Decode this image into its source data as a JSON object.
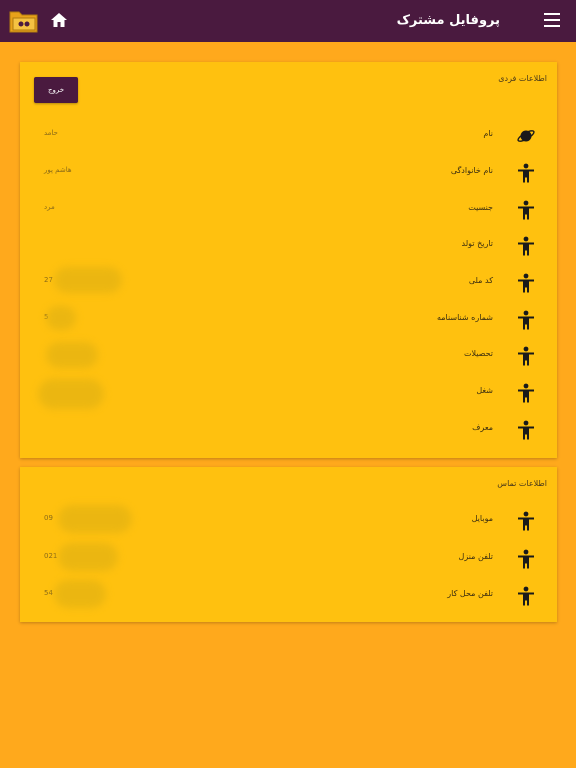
{
  "header": {
    "title": "پروفایل مشترک",
    "icons": [
      "menu-icon",
      "home-icon",
      "folder-icon"
    ]
  },
  "personal": {
    "title": "اطلاعات فردی",
    "logout_label": "خروج",
    "rows": [
      {
        "label": "نام",
        "value": "حامد",
        "icon": "planet-icon"
      },
      {
        "label": "نام خانوادگی",
        "value": "هاشم پور",
        "icon": "person-icon"
      },
      {
        "label": "جنسیت",
        "value": "مرد",
        "icon": "person-icon"
      },
      {
        "label": "تاریخ تولد",
        "value": "",
        "icon": "person-icon"
      },
      {
        "label": "کد ملی",
        "value": "27",
        "icon": "person-icon"
      },
      {
        "label": "شماره شناسنامه",
        "value": "5",
        "icon": "person-icon"
      },
      {
        "label": "تحصیلات",
        "value": "",
        "icon": "person-icon"
      },
      {
        "label": "شغل",
        "value": "",
        "icon": "person-icon"
      },
      {
        "label": "معرف",
        "value": "",
        "icon": "person-icon"
      }
    ]
  },
  "contact": {
    "title": "اطلاعات تماس",
    "rows": [
      {
        "label": "موبایل",
        "value": "09",
        "icon": "person-icon"
      },
      {
        "label": "تلفن منزل",
        "value": "021",
        "icon": "person-icon"
      },
      {
        "label": "تلفن محل کار",
        "value": "54",
        "icon": "person-icon"
      }
    ]
  },
  "colors": {
    "background": "#ffa91c",
    "card": "#ffc10f",
    "primary": "#4a1a3f"
  }
}
